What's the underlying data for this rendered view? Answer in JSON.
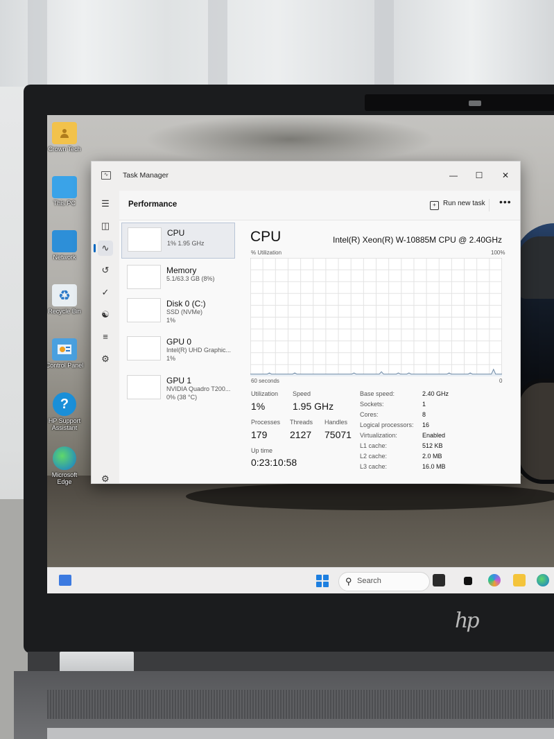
{
  "desktop": {
    "icons": [
      {
        "label": "Crown Tech",
        "icon": "folder-user-icon"
      },
      {
        "label": "This PC",
        "icon": "monitor-icon"
      },
      {
        "label": "Network",
        "icon": "network-icon"
      },
      {
        "label": "Recycle Bin",
        "icon": "recycle-bin-icon"
      },
      {
        "label": "Control Panel",
        "icon": "control-panel-icon"
      },
      {
        "label": "HP Support Assistant",
        "icon": "help-icon"
      },
      {
        "label": "Microsoft Edge",
        "icon": "edge-icon"
      }
    ]
  },
  "taskbar": {
    "search_label": "Search"
  },
  "task_manager": {
    "title": "Task Manager",
    "page_title": "Performance",
    "run_new_task": "Run new task",
    "more": "•••",
    "resources": [
      {
        "name": "CPU",
        "sub1": "1%  1.95 GHz",
        "sub2": ""
      },
      {
        "name": "Memory",
        "sub1": "5.1/63.3 GB (8%)",
        "sub2": ""
      },
      {
        "name": "Disk 0 (C:)",
        "sub1": "SSD (NVMe)",
        "sub2": "1%"
      },
      {
        "name": "GPU 0",
        "sub1": "Intel(R) UHD Graphic...",
        "sub2": "1%"
      },
      {
        "name": "GPU 1",
        "sub1": "NVIDIA Quadro T200...",
        "sub2": "0% (38 °C)"
      }
    ],
    "cpu": {
      "title": "CPU",
      "model": "Intel(R) Xeon(R) W-10885M CPU @ 2.40GHz",
      "util_label": "% Utilization",
      "util_max": "100%",
      "time_left": "60 seconds",
      "time_right": "0",
      "utilization_label": "Utilization",
      "utilization": "1%",
      "speed_label": "Speed",
      "speed": "1.95 GHz",
      "processes_label": "Processes",
      "processes": "179",
      "threads_label": "Threads",
      "threads": "2127",
      "handles_label": "Handles",
      "handles": "75071",
      "uptime_label": "Up time",
      "uptime": "0:23:10:58",
      "specs": [
        {
          "k": "Base speed:",
          "v": "2.40 GHz"
        },
        {
          "k": "Sockets:",
          "v": "1"
        },
        {
          "k": "Cores:",
          "v": "8"
        },
        {
          "k": "Logical processors:",
          "v": "16"
        },
        {
          "k": "Virtualization:",
          "v": "Enabled"
        },
        {
          "k": "L1 cache:",
          "v": "512 KB"
        },
        {
          "k": "L2 cache:",
          "v": "2.0 MB"
        },
        {
          "k": "L3 cache:",
          "v": "16.0 MB"
        }
      ],
      "history": [
        2,
        2,
        2,
        2,
        2,
        2,
        2,
        2,
        2,
        3,
        2,
        2,
        2,
        2,
        2,
        2,
        2,
        2,
        2,
        2,
        2,
        3,
        2,
        2,
        2,
        2,
        2,
        2,
        2,
        2,
        2,
        2,
        2,
        2,
        2,
        2,
        2,
        2,
        2,
        2,
        2,
        2,
        2,
        2,
        2,
        2,
        2,
        2,
        2,
        3,
        2,
        2,
        2,
        2,
        2,
        2,
        2,
        2,
        2,
        2,
        2,
        2,
        4,
        2,
        2,
        2,
        2,
        2,
        2,
        2,
        3,
        2,
        2,
        2,
        2,
        3,
        2,
        2,
        2,
        2,
        2,
        2,
        2,
        2,
        2,
        2,
        2,
        2,
        2,
        2,
        2,
        2,
        2,
        2,
        3,
        2,
        2,
        2,
        2,
        2,
        2,
        2,
        2,
        2,
        3,
        2,
        2,
        2,
        2,
        2,
        2,
        2,
        2,
        2,
        2,
        6,
        2,
        2,
        2,
        2
      ]
    }
  },
  "laptop": {
    "brand": "hp"
  }
}
